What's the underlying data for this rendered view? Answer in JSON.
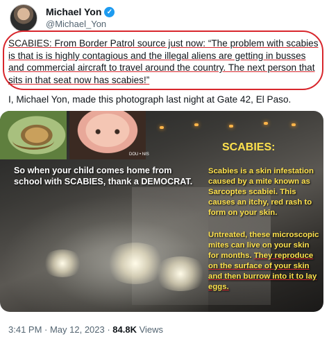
{
  "author": {
    "display_name": "Michael Yon",
    "handle": "@Michael_Yon",
    "verified_icon": "verified-badge-icon",
    "verified_color": "#1d9bf0"
  },
  "tweet": {
    "text_part1": "SCABIES:",
    "text_part2": " From Border Patrol source just now: “The problem with scabies is that is is highly contagious and the illegal aliens are getting in busses and commercial aircraft to travel around the country. The next person that sits in that seat now has scabies!”",
    "caption": "I, Michael Yon, made this photograph last night at Gate 42, El Paso."
  },
  "image": {
    "left_text": "So when your child comes home from school with SCABIES, thank a DEMOCRAT.",
    "title": "SCABIES:",
    "para1": "Scabies is a skin infestation caused by a mite known as Sarcoptes scabiei. This causes an itchy, red rash to form on your skin.",
    "para2_a": "Untreated, these microscopic mites can live on your skin for months. ",
    "para2_b": "They reproduce on the surface of your skin and then burrow into it to lay eggs.",
    "baby_tag": "DOU • NIS",
    "accent_color": "#ffe24d",
    "highlight_color": "#d8262c"
  },
  "meta": {
    "time": "3:41 PM · May 12, 2023 · ",
    "views_count": "84.8K",
    "views_label": " Views"
  }
}
